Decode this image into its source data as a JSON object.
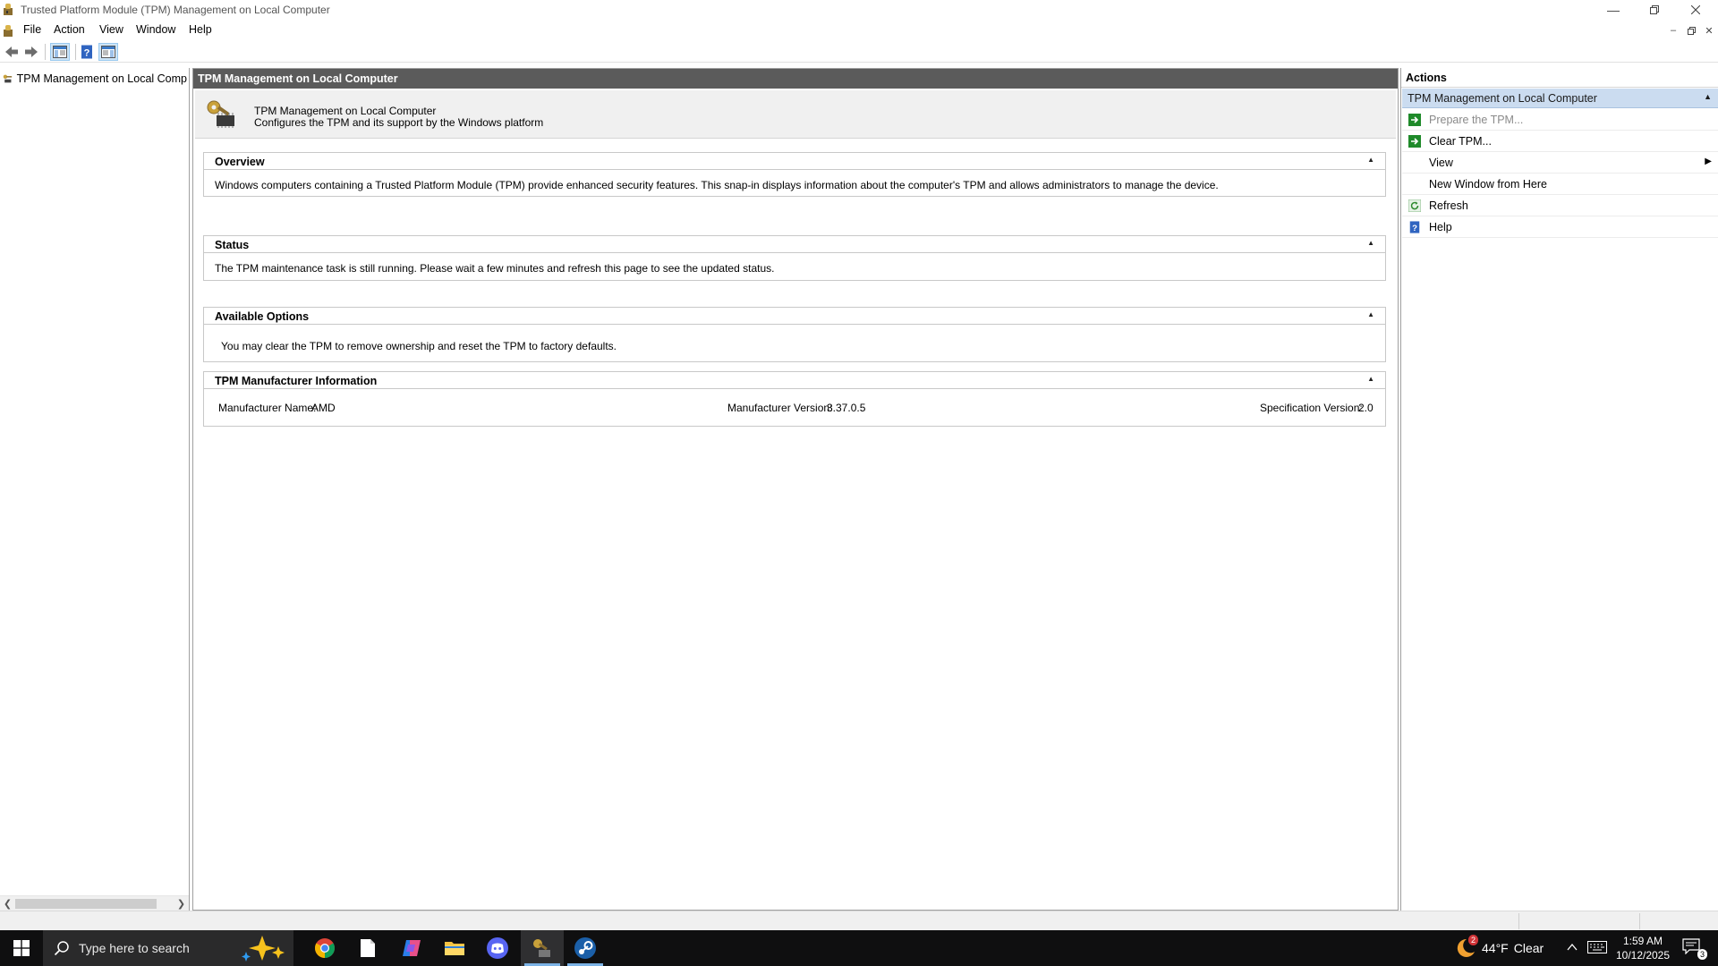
{
  "window": {
    "title": "Trusted Platform Module (TPM) Management on Local Computer",
    "minimize_icon": "minimize-icon",
    "restore_icon": "restore-icon",
    "close_icon": "close-icon"
  },
  "menu": {
    "items": [
      "File",
      "Action",
      "View",
      "Window",
      "Help"
    ]
  },
  "toolbar": {
    "buttons": [
      "back-arrow-icon",
      "forward-arrow-icon",
      "show-hide-tree-icon",
      "help-icon",
      "show-hide-action-pane-icon"
    ]
  },
  "tree": {
    "root_label": "TPM Management on Local Comp"
  },
  "main": {
    "header": "TPM Management on Local Computer",
    "banner": {
      "title": "TPM Management on Local Computer",
      "subtitle": "Configures the TPM and its support by the Windows platform"
    },
    "sections": {
      "overview": {
        "title": "Overview",
        "text": "Windows computers containing a Trusted Platform Module (TPM) provide enhanced security features. This snap-in displays information about the computer's TPM and allows administrators to manage the device."
      },
      "status": {
        "title": "Status",
        "text": "The TPM maintenance task is still running. Please wait a few minutes and refresh this page to see the updated status."
      },
      "options": {
        "title": "Available Options",
        "text": "You may clear the TPM to remove ownership and reset the TPM to factory defaults."
      },
      "manufacturer": {
        "title": "TPM Manufacturer Information",
        "name_label": "Manufacturer Name:",
        "name_value": "AMD",
        "version_label": "Manufacturer Version:",
        "version_value": "3.37.0.5",
        "spec_label": "Specification Version:",
        "spec_value": "2.0"
      }
    }
  },
  "actions": {
    "title": "Actions",
    "group": "TPM Management on Local Computer",
    "items": {
      "prepare": "Prepare the TPM...",
      "clear": "Clear TPM...",
      "view": "View",
      "new_window": "New Window from Here",
      "refresh": "Refresh",
      "help": "Help"
    }
  },
  "taskbar": {
    "search_placeholder": "Type here to search",
    "apps": [
      "chrome-icon",
      "notepad-icon",
      "copilot-icon",
      "file-explorer-icon",
      "discord-icon",
      "tpm-icon",
      "steam-icon"
    ],
    "weather_badge": "2",
    "weather_temp": "44°F",
    "weather_cond": "Clear",
    "time": "1:59 AM",
    "date": "10/12/2025",
    "notification_count": "3"
  },
  "colors": {
    "header_bg": "#5b5b5b",
    "actions_group_bg": "#cbdcf0",
    "taskbar_bg": "#0f0f10",
    "accent": "#0078d7"
  }
}
